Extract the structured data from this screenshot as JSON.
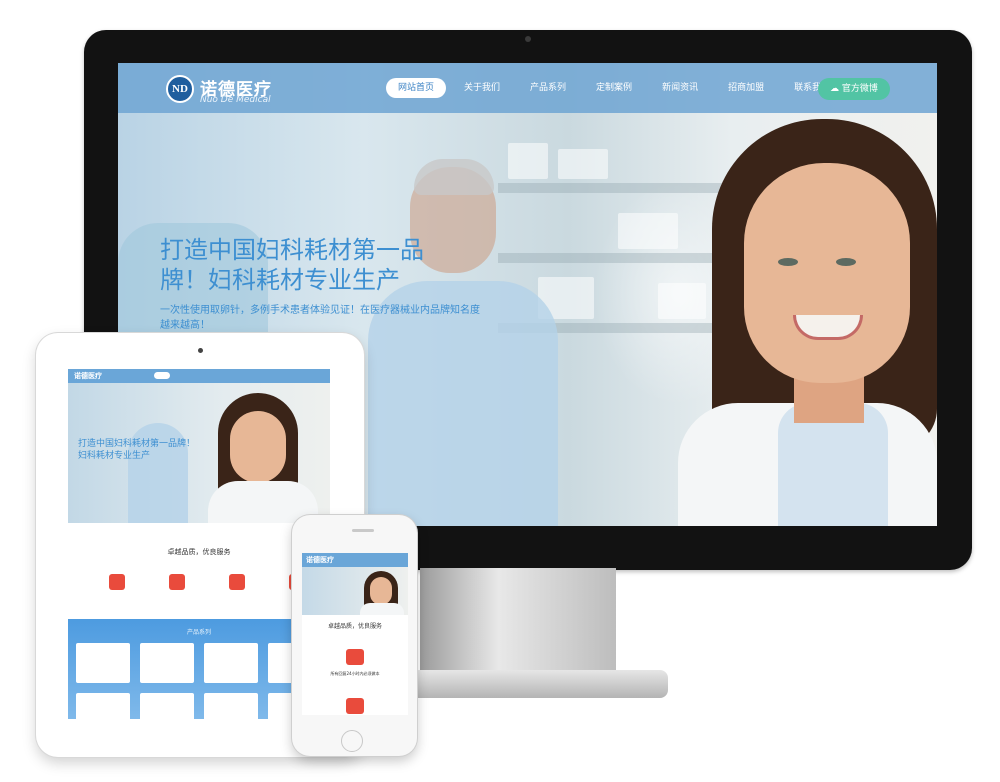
{
  "brand": {
    "name_cn": "诺德医疗",
    "name_en": "Nuo De Medical",
    "logo_mark": "ND"
  },
  "nav": {
    "items": [
      "网站首页",
      "关于我们",
      "产品系列",
      "定制案例",
      "新闻资讯",
      "招商加盟",
      "联系我们"
    ],
    "active_index": 0,
    "weibo_button": "官方微博"
  },
  "hero": {
    "title": "打造中国妇科耗材第一品牌！妇科耗材专业生产",
    "subtitle": "一次性使用取卵针，多例手术患者体验见证！在医疗器械业内品牌知名度越来越高！"
  },
  "sections": {
    "quality_title": "卓越品质，优良服务",
    "products_title": "产品系列",
    "service_title": "所有回复24小时内必须做本"
  },
  "colors": {
    "accent": "#3d8fd1",
    "nav": "#6aa6d8",
    "weibo": "#52c4a4",
    "icon_red": "#e94b3c"
  },
  "icons": [
    "logo-icon",
    "weibo-icon",
    "medical-kit-icon",
    "heart-icon",
    "phone-home-icon"
  ]
}
